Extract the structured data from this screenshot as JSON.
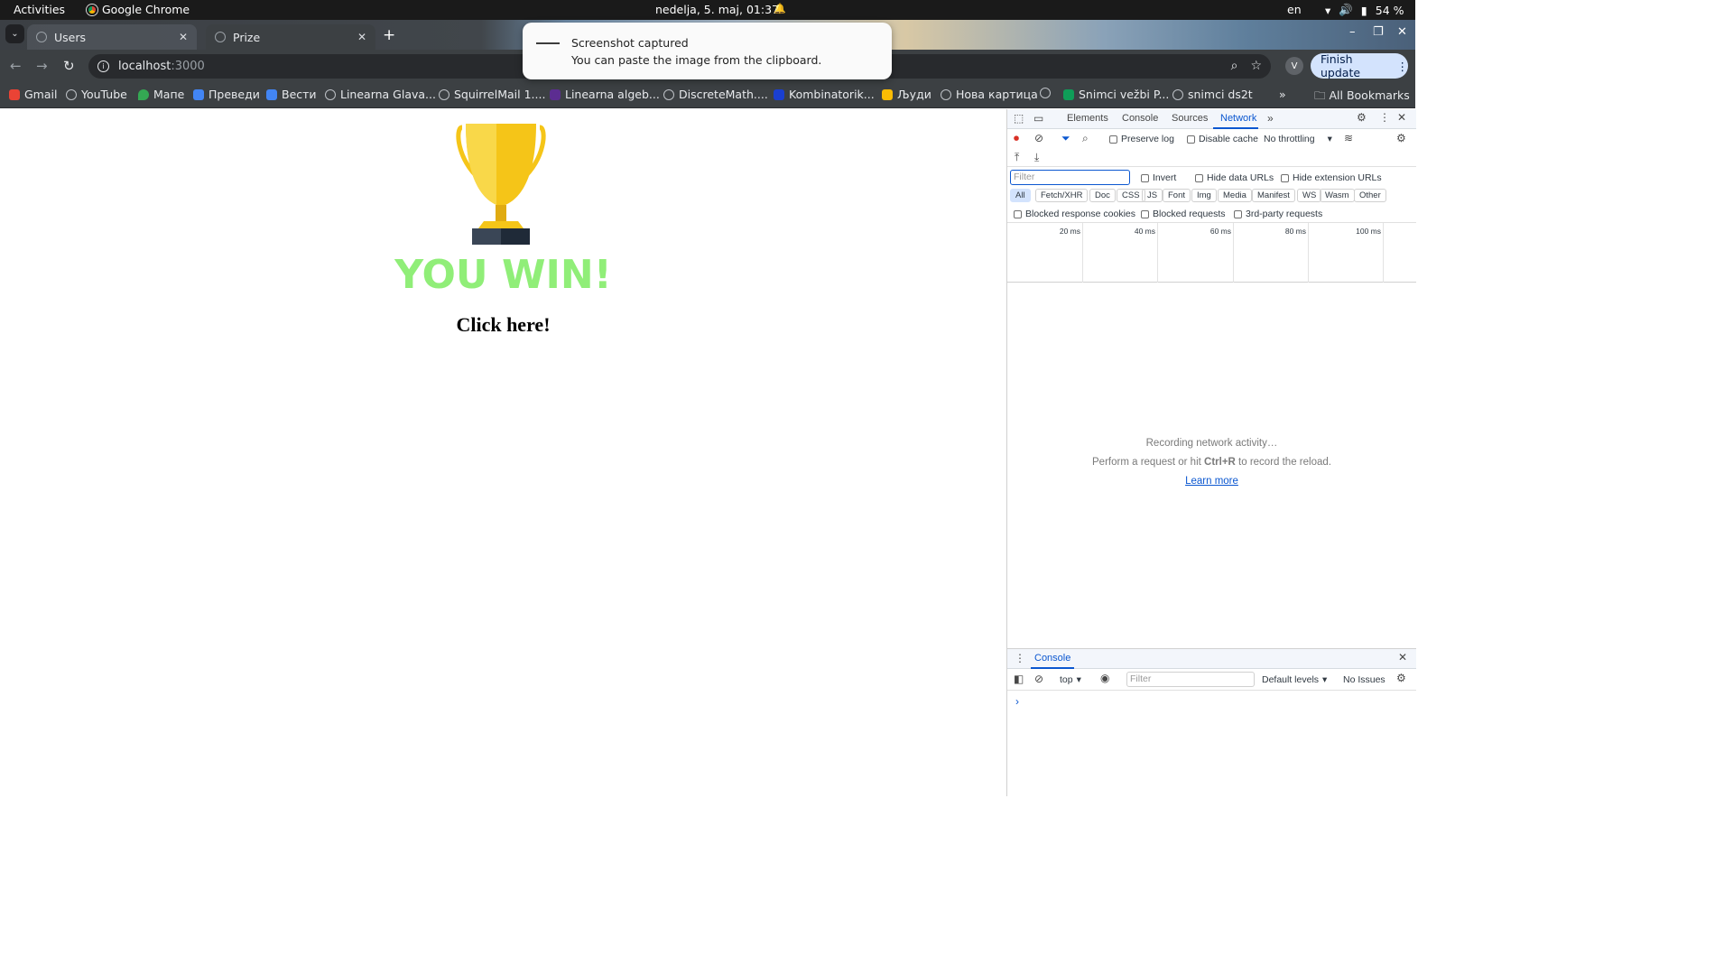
{
  "system_bar": {
    "activities": "Activities",
    "app_name": "Google Chrome",
    "clock": "nedelja,  5. maj, 01:37",
    "language": "en",
    "battery": "54 %"
  },
  "tabs": [
    {
      "label": "Users",
      "active": false
    },
    {
      "label": "Prize",
      "active": true
    }
  ],
  "toolbar": {
    "url_host": "localhost",
    "url_port": ":3000",
    "profile_initial": "V",
    "finish_update_label": "Finish update"
  },
  "bookmarks": {
    "items": [
      {
        "label": "Gmail",
        "icon": "gmail-icon"
      },
      {
        "label": "YouTube",
        "icon": "globe-icon"
      },
      {
        "label": "Мапе",
        "icon": "maps-icon"
      },
      {
        "label": "Преведи",
        "icon": "translate-icon"
      },
      {
        "label": "Вести",
        "icon": "news-icon"
      },
      {
        "label": "Linearna Glava...",
        "icon": "globe-icon"
      },
      {
        "label": "SquirrelMail 1....",
        "icon": "globe-icon"
      },
      {
        "label": "Linearna algeb...",
        "icon": "bookmark-icon"
      },
      {
        "label": "DiscreteMath....",
        "icon": "globe-icon"
      },
      {
        "label": "Kombinatorik...",
        "icon": "m-logo-icon"
      },
      {
        "label": "Људи",
        "icon": "contacts-icon"
      },
      {
        "label": "Нова картица",
        "icon": "globe-icon"
      },
      {
        "label": "",
        "icon": "globe-icon"
      },
      {
        "label": "Snimci vežbi P...",
        "icon": "sheets-icon"
      },
      {
        "label": "snimci ds2t",
        "icon": "globe-icon"
      }
    ],
    "overflow": "»",
    "all_bookmarks": "All Bookmarks"
  },
  "notification": {
    "title": "Screenshot captured",
    "body": "You can paste the image from the clipboard."
  },
  "page": {
    "heading": "YOU WIN!",
    "link": "Click here!"
  },
  "devtools": {
    "tabs": [
      "Elements",
      "Console",
      "Sources",
      "Network"
    ],
    "active_tab": "Network",
    "preserve_log": "Preserve log",
    "disable_cache": "Disable cache",
    "throttling": "No throttling",
    "filter_placeholder": "Filter",
    "invert": "Invert",
    "hide_data_urls": "Hide data URLs",
    "hide_extension_urls": "Hide extension URLs",
    "type_filters": [
      "All",
      "Fetch/XHR",
      "Doc",
      "CSS",
      "JS",
      "Font",
      "Img",
      "Media",
      "Manifest",
      "WS",
      "Wasm",
      "Other"
    ],
    "blocked_response_cookies": "Blocked response cookies",
    "blocked_requests": "Blocked requests",
    "third_party": "3rd-party requests",
    "timeline_ticks": [
      "20 ms",
      "40 ms",
      "60 ms",
      "80 ms",
      "100 ms"
    ],
    "empty_line1": "Recording network activity…",
    "empty_line2_pre": "Perform a request or hit ",
    "empty_line2_key": "Ctrl+R",
    "empty_line2_post": " to record the reload.",
    "learn_more": "Learn more"
  },
  "console_drawer": {
    "tab": "Console",
    "context": "top",
    "filter_placeholder": "Filter",
    "levels": "Default levels",
    "issues": "No Issues",
    "prompt": "›"
  },
  "colors": {
    "win_green": "#90ee78",
    "trophy_gold": "#f5c518",
    "devtools_blue": "#0b57d0"
  }
}
